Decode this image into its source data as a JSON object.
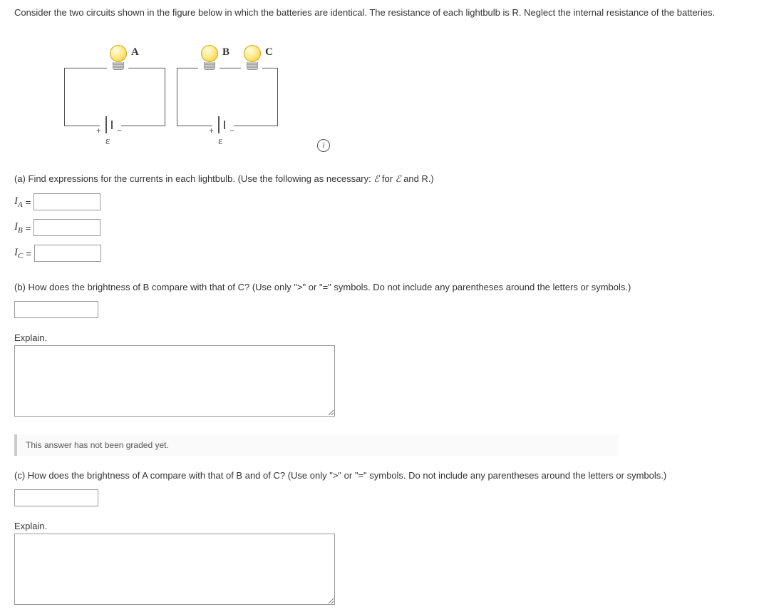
{
  "intro": "Consider the two circuits shown in the figure below in which the batteries are identical. The resistance of each lightbulb is R. Neglect the internal resistance of the batteries.",
  "bulbs": {
    "a": "A",
    "b": "B",
    "c": "C"
  },
  "battery": {
    "plus": "+",
    "minus": "−",
    "eps": "ε"
  },
  "info_icon": "i",
  "part_a": {
    "text_pre": "(a) Find expressions for the currents in each lightbulb. (Use the following as necessary: ",
    "e1": "ℰ",
    "text_mid": " for ",
    "e2": "ℰ",
    "text_post": " and R.)",
    "ia": "I",
    "ia_sub": "A",
    "ib": "I",
    "ib_sub": "B",
    "ic": "I",
    "ic_sub": "C",
    "eq": "="
  },
  "part_b": {
    "text": "(b) How does the brightness of B compare with that of C? (Use only \">\" or \"=\" symbols. Do not include any parentheses around the letters or symbols.)",
    "explain": "Explain."
  },
  "grade_msg": "This answer has not been graded yet.",
  "part_c": {
    "text": "(c) How does the brightness of A compare with that of B and of C? (Use only \">\" or \"=\" symbols. Do not include any parentheses around the letters or symbols.)",
    "explain": "Explain."
  }
}
